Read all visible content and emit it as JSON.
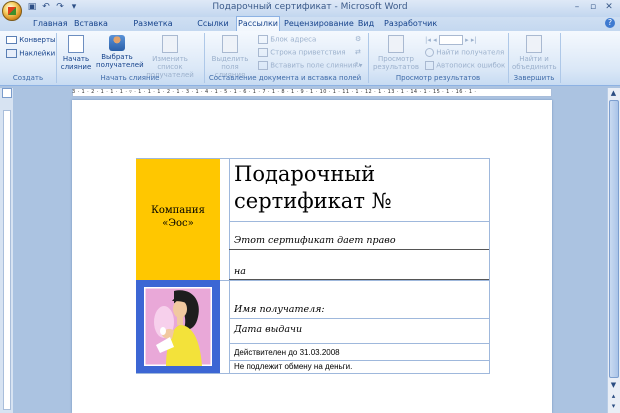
{
  "window": {
    "title": "Подарочный сертификат - Microsoft Word"
  },
  "tabs": [
    "Главная",
    "Вставка",
    "Разметка страницы",
    "Ссылки",
    "Рассылки",
    "Рецензирование",
    "Вид",
    "Разработчик"
  ],
  "active_tab": "Рассылки",
  "ribbon": {
    "groups": [
      {
        "label": "Создать",
        "items": [
          "Конверты",
          "Наклейки"
        ]
      },
      {
        "label": "Начать слияние",
        "items": [
          "Начать слияние",
          "Выбрать получателей",
          "Изменить список получателей"
        ]
      },
      {
        "label": "Составление документа и вставка полей",
        "items": [
          "Выделить поля слияния",
          "Блок адреса",
          "Строка приветствия",
          "Вставить поле слияния"
        ]
      },
      {
        "label": "Просмотр результатов",
        "items": [
          "Просмотр результатов",
          "Найти получателя",
          "Автопоиск ошибок"
        ]
      },
      {
        "label": "Завершить",
        "items": [
          "Найти и объединить"
        ]
      }
    ],
    "labels": {
      "envelopes": "Конверты",
      "labels": "Наклейки",
      "start_merge_1": "Начать",
      "start_merge_2": "слияние",
      "select_recipients_1": "Выбрать",
      "select_recipients_2": "получателей",
      "edit_list_1": "Изменить список",
      "edit_list_2": "получателей",
      "highlight_1": "Выделить",
      "highlight_2": "поля слияния",
      "address_block": "Блок адреса",
      "greeting_line": "Строка приветствия",
      "insert_field": "Вставить поле слияния",
      "preview_1": "Просмотр",
      "preview_2": "результатов",
      "find_recipient": "Найти получателя",
      "auto_check": "Автопоиск ошибок",
      "finish_1": "Найти и",
      "finish_2": "объединить"
    }
  },
  "ruler": {
    "numbers": "3 · 1 · 2 · 1 · 1 · 1 · ▿ · 1 · 1 · 1 · 2 · 1 · 3 · 1 · 4 · 1 · 5 · 1 · 6 · 1 · 7 · 1 · 8 · 1 · 9 · 1 · 10 · 1 · 11 · 1 · 12 · 1 · 13 · 1 · 14 · 1 · 15 · 1 · 16 · 1 ·"
  },
  "certificate": {
    "company_line1": "Компания",
    "company_line2": "«Эос»",
    "title_line1": "Подарочный",
    "title_line2": "сертификат №",
    "grants": "Этот сертификат дает право",
    "on": "на",
    "recipient": "Имя получателя:",
    "issue_date": "Дата выдачи",
    "valid_until": "Действителен до 31.03.2008",
    "no_exchange": "Не подлежит обмену на деньги."
  },
  "colors": {
    "yellow_panel": "#ffc700",
    "blue_panel": "#3c66d4",
    "photo_bg": "#e9a8d8"
  }
}
